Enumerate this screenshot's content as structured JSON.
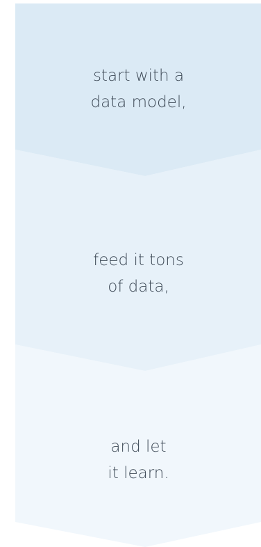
{
  "steps": [
    {
      "line1": "start with a",
      "line2": "data model,",
      "color": "#dbeaf5"
    },
    {
      "line1": "feed it tons",
      "line2": "of data,",
      "color": "#e7f1f9"
    },
    {
      "line1": "and let",
      "line2": "it learn.",
      "color": "#f1f7fc"
    }
  ]
}
